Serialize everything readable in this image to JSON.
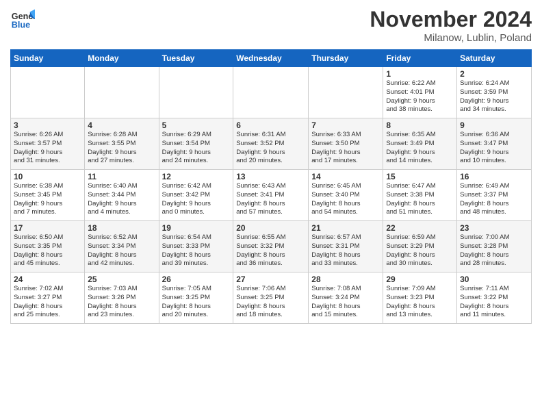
{
  "header": {
    "logo_line1": "General",
    "logo_line2": "Blue",
    "month": "November 2024",
    "location": "Milanow, Lublin, Poland"
  },
  "weekdays": [
    "Sunday",
    "Monday",
    "Tuesday",
    "Wednesday",
    "Thursday",
    "Friday",
    "Saturday"
  ],
  "weeks": [
    [
      {
        "day": "",
        "info": ""
      },
      {
        "day": "",
        "info": ""
      },
      {
        "day": "",
        "info": ""
      },
      {
        "day": "",
        "info": ""
      },
      {
        "day": "",
        "info": ""
      },
      {
        "day": "1",
        "info": "Sunrise: 6:22 AM\nSunset: 4:01 PM\nDaylight: 9 hours\nand 38 minutes."
      },
      {
        "day": "2",
        "info": "Sunrise: 6:24 AM\nSunset: 3:59 PM\nDaylight: 9 hours\nand 34 minutes."
      }
    ],
    [
      {
        "day": "3",
        "info": "Sunrise: 6:26 AM\nSunset: 3:57 PM\nDaylight: 9 hours\nand 31 minutes."
      },
      {
        "day": "4",
        "info": "Sunrise: 6:28 AM\nSunset: 3:55 PM\nDaylight: 9 hours\nand 27 minutes."
      },
      {
        "day": "5",
        "info": "Sunrise: 6:29 AM\nSunset: 3:54 PM\nDaylight: 9 hours\nand 24 minutes."
      },
      {
        "day": "6",
        "info": "Sunrise: 6:31 AM\nSunset: 3:52 PM\nDaylight: 9 hours\nand 20 minutes."
      },
      {
        "day": "7",
        "info": "Sunrise: 6:33 AM\nSunset: 3:50 PM\nDaylight: 9 hours\nand 17 minutes."
      },
      {
        "day": "8",
        "info": "Sunrise: 6:35 AM\nSunset: 3:49 PM\nDaylight: 9 hours\nand 14 minutes."
      },
      {
        "day": "9",
        "info": "Sunrise: 6:36 AM\nSunset: 3:47 PM\nDaylight: 9 hours\nand 10 minutes."
      }
    ],
    [
      {
        "day": "10",
        "info": "Sunrise: 6:38 AM\nSunset: 3:45 PM\nDaylight: 9 hours\nand 7 minutes."
      },
      {
        "day": "11",
        "info": "Sunrise: 6:40 AM\nSunset: 3:44 PM\nDaylight: 9 hours\nand 4 minutes."
      },
      {
        "day": "12",
        "info": "Sunrise: 6:42 AM\nSunset: 3:42 PM\nDaylight: 9 hours\nand 0 minutes."
      },
      {
        "day": "13",
        "info": "Sunrise: 6:43 AM\nSunset: 3:41 PM\nDaylight: 8 hours\nand 57 minutes."
      },
      {
        "day": "14",
        "info": "Sunrise: 6:45 AM\nSunset: 3:40 PM\nDaylight: 8 hours\nand 54 minutes."
      },
      {
        "day": "15",
        "info": "Sunrise: 6:47 AM\nSunset: 3:38 PM\nDaylight: 8 hours\nand 51 minutes."
      },
      {
        "day": "16",
        "info": "Sunrise: 6:49 AM\nSunset: 3:37 PM\nDaylight: 8 hours\nand 48 minutes."
      }
    ],
    [
      {
        "day": "17",
        "info": "Sunrise: 6:50 AM\nSunset: 3:35 PM\nDaylight: 8 hours\nand 45 minutes."
      },
      {
        "day": "18",
        "info": "Sunrise: 6:52 AM\nSunset: 3:34 PM\nDaylight: 8 hours\nand 42 minutes."
      },
      {
        "day": "19",
        "info": "Sunrise: 6:54 AM\nSunset: 3:33 PM\nDaylight: 8 hours\nand 39 minutes."
      },
      {
        "day": "20",
        "info": "Sunrise: 6:55 AM\nSunset: 3:32 PM\nDaylight: 8 hours\nand 36 minutes."
      },
      {
        "day": "21",
        "info": "Sunrise: 6:57 AM\nSunset: 3:31 PM\nDaylight: 8 hours\nand 33 minutes."
      },
      {
        "day": "22",
        "info": "Sunrise: 6:59 AM\nSunset: 3:29 PM\nDaylight: 8 hours\nand 30 minutes."
      },
      {
        "day": "23",
        "info": "Sunrise: 7:00 AM\nSunset: 3:28 PM\nDaylight: 8 hours\nand 28 minutes."
      }
    ],
    [
      {
        "day": "24",
        "info": "Sunrise: 7:02 AM\nSunset: 3:27 PM\nDaylight: 8 hours\nand 25 minutes."
      },
      {
        "day": "25",
        "info": "Sunrise: 7:03 AM\nSunset: 3:26 PM\nDaylight: 8 hours\nand 23 minutes."
      },
      {
        "day": "26",
        "info": "Sunrise: 7:05 AM\nSunset: 3:25 PM\nDaylight: 8 hours\nand 20 minutes."
      },
      {
        "day": "27",
        "info": "Sunrise: 7:06 AM\nSunset: 3:25 PM\nDaylight: 8 hours\nand 18 minutes."
      },
      {
        "day": "28",
        "info": "Sunrise: 7:08 AM\nSunset: 3:24 PM\nDaylight: 8 hours\nand 15 minutes."
      },
      {
        "day": "29",
        "info": "Sunrise: 7:09 AM\nSunset: 3:23 PM\nDaylight: 8 hours\nand 13 minutes."
      },
      {
        "day": "30",
        "info": "Sunrise: 7:11 AM\nSunset: 3:22 PM\nDaylight: 8 hours\nand 11 minutes."
      }
    ]
  ]
}
